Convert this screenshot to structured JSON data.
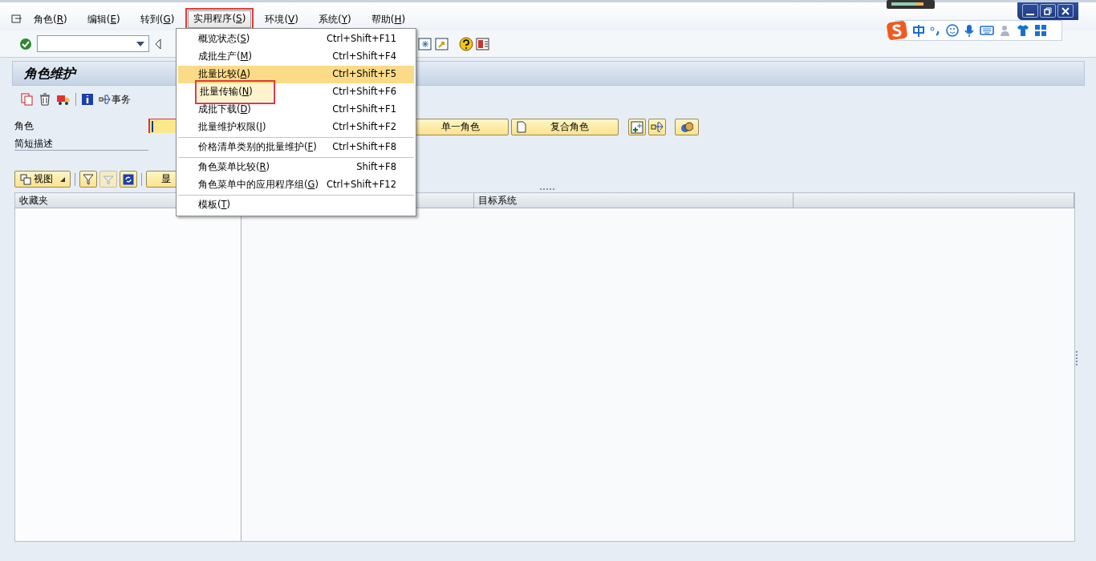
{
  "menubar": [
    {
      "label": "角色(R)",
      "selected": false,
      "marked": false
    },
    {
      "label": "编辑(E)",
      "selected": false,
      "marked": false
    },
    {
      "label": "转到(G)",
      "selected": false,
      "marked": false
    },
    {
      "label": "实用程序(S)",
      "selected": true,
      "marked": true
    },
    {
      "label": "环境(V)",
      "selected": false,
      "marked": false
    },
    {
      "label": "系统(Y)",
      "selected": false,
      "marked": false
    },
    {
      "label": "帮助(H)",
      "selected": false,
      "marked": false
    }
  ],
  "screen": {
    "title": "角色维护",
    "transaction_link": "事务"
  },
  "fields": [
    {
      "label": "角色"
    },
    {
      "label": "简短描述"
    }
  ],
  "role_buttons": [
    {
      "label": "单一角色"
    },
    {
      "label": "复合角色"
    }
  ],
  "tree_toolbar": {
    "view_button": "视图",
    "display_button": "显"
  },
  "tree": {
    "favorites_header": "收藏夹",
    "target_column": "目标系统"
  },
  "dropdown_menu": {
    "groups": [
      [
        {
          "label": "概览状态(S)",
          "shortcut": "Ctrl+Shift+F11",
          "selected": false,
          "marked": false
        },
        {
          "label": "成批生产(M)",
          "shortcut": "Ctrl+Shift+F4",
          "selected": false,
          "marked": false
        },
        {
          "label": "批量比较(A)",
          "shortcut": "Ctrl+Shift+F5",
          "selected": true,
          "marked": false
        },
        {
          "label": "批量传输(N)",
          "shortcut": "Ctrl+Shift+F6",
          "selected": false,
          "marked": true
        },
        {
          "label": "成批下载(D)",
          "shortcut": "Ctrl+Shift+F1",
          "selected": false,
          "marked": false
        },
        {
          "label": "批量维护权限(I)",
          "shortcut": "Ctrl+Shift+F2",
          "selected": false,
          "marked": false
        }
      ],
      [
        {
          "label": "价格清单类别的批量维护(F)",
          "shortcut": "Ctrl+Shift+F8",
          "selected": false,
          "marked": false
        }
      ],
      [
        {
          "label": "角色菜单比较(R)",
          "shortcut": "Shift+F8",
          "selected": false,
          "marked": false
        },
        {
          "label": "角色菜单中的应用程序组(G)",
          "shortcut": "Ctrl+Shift+F12",
          "selected": false,
          "marked": false
        }
      ],
      [
        {
          "label": "模板(T)",
          "selected": false,
          "marked": false
        }
      ]
    ]
  }
}
